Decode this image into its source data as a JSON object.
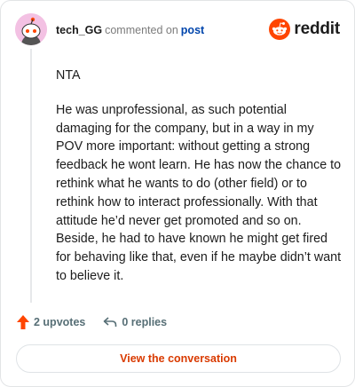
{
  "brand": {
    "name": "reddit",
    "logo_icon": "reddit-logo-icon",
    "accent": "#ff4500"
  },
  "comment": {
    "username": "tech_GG",
    "action": "commented on",
    "post_link": "post",
    "avatar_icon": "snoo-avatar-icon",
    "paragraphs": [
      "NTA",
      "He was unprofessional, as such potential damaging for the company, but in a way in my POV more important: without getting a strong feedback he wont learn. He has now the chance to rethink what he wants to do (other field) or to rethink how to interact professionally. With that attitude he’d never get promoted and so on. Beside, he had to have known he might get fired for behaving like that, even if he maybe didn’t want to believe it."
    ]
  },
  "footer": {
    "upvotes_label": "2 upvotes",
    "replies_label": "0 replies",
    "view_button": "View the conversation"
  }
}
